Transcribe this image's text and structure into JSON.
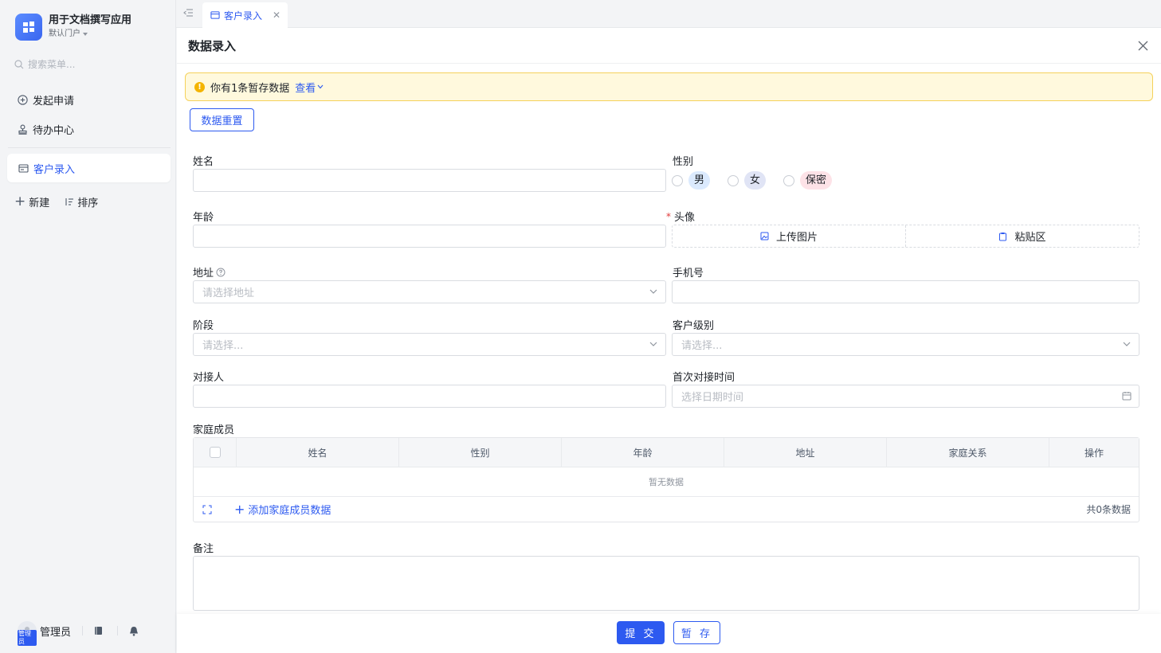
{
  "app": {
    "title": "用于文档撰写应用",
    "portal": "默认门户"
  },
  "sidebar": {
    "search_placeholder": "搜索菜单...",
    "items": [
      {
        "label": "发起申请",
        "icon": "plus-circle-icon"
      },
      {
        "label": "待办中心",
        "icon": "stamp-icon"
      }
    ],
    "active_item": {
      "label": "客户录入",
      "icon": "form-icon"
    },
    "actions": {
      "new_label": "新建",
      "sort_label": "排序"
    },
    "user": {
      "name": "管理员",
      "role_tag": "管理员"
    }
  },
  "tabs": [
    {
      "label": "客户录入",
      "active": true
    }
  ],
  "panel": {
    "title": "数据录入",
    "alert": {
      "text": "你有1条暂存数据",
      "link": "查看"
    },
    "reset_label": "数据重置"
  },
  "form": {
    "name": {
      "label": "姓名",
      "value": ""
    },
    "gender": {
      "label": "性别",
      "options": [
        {
          "label": "男",
          "bg": "#dbeafe",
          "color": "#1f2329"
        },
        {
          "label": "女",
          "bg": "#e0e4f5",
          "color": "#1f2329"
        },
        {
          "label": "保密",
          "bg": "#fde2e7",
          "color": "#1f2329"
        }
      ]
    },
    "age": {
      "label": "年龄",
      "value": ""
    },
    "avatar": {
      "label": "头像",
      "required": "*",
      "upload_label": "上传图片",
      "paste_label": "粘贴区"
    },
    "address": {
      "label": "地址",
      "placeholder": "请选择地址"
    },
    "phone": {
      "label": "手机号",
      "value": ""
    },
    "stage": {
      "label": "阶段",
      "placeholder": "请选择..."
    },
    "level": {
      "label": "客户级别",
      "placeholder": "请选择..."
    },
    "contact": {
      "label": "对接人",
      "value": ""
    },
    "first_contact": {
      "label": "首次对接时间",
      "placeholder": "选择日期时间"
    },
    "family": {
      "label": "家庭成员",
      "columns": [
        "姓名",
        "性别",
        "年龄",
        "地址",
        "家庭关系",
        "操作"
      ],
      "empty_text": "暂无数据",
      "add_label": "添加家庭成员数据",
      "total_text": "共0条数据"
    },
    "remark": {
      "label": "备注",
      "value": ""
    }
  },
  "footer": {
    "submit_label": "提 交",
    "save_label": "暂 存"
  },
  "colors": {
    "accent": "#2d5af0",
    "warning_bg": "#fff9dd",
    "warning_border": "#f5d15b"
  }
}
